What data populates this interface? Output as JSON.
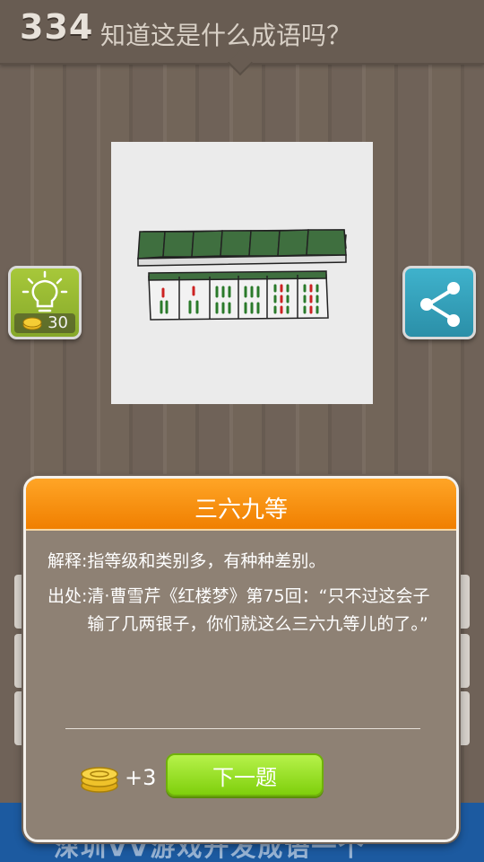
{
  "header": {
    "level": "334",
    "question": "知道这是什么成语吗？"
  },
  "hint": {
    "cost": "30",
    "icon": "lightbulb-icon"
  },
  "share": {
    "icon": "share-icon"
  },
  "banner": {
    "text": "深圳VV游戏开发成语一个"
  },
  "modal": {
    "answer": "三六九等",
    "explanation": "解释:指等级和类别多，有种种差别。",
    "source_label": "出处:",
    "source_text": "清·曹雪芹《红楼梦》第75回：“只不过这会子输了几两银子，你们就这么三六九等儿的了。”",
    "reward": "+3",
    "next_label": "下一题"
  },
  "colors": {
    "title_bar": "#f07f00",
    "next_button": "#7fcf0c",
    "modal_bg": "#8e8174"
  }
}
